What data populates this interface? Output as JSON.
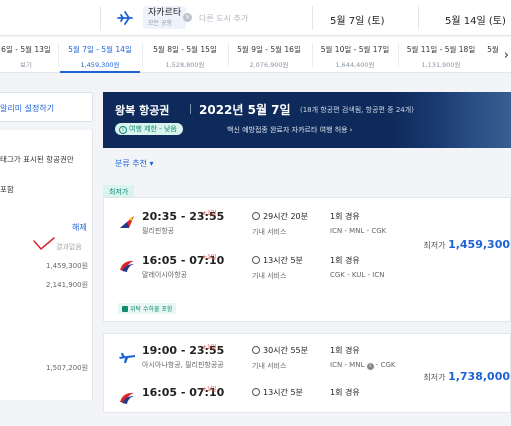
{
  "search": {
    "destination": {
      "city": "자카르타",
      "sub": "모든 공항"
    },
    "add_city_placeholder": "다른 도시 추가",
    "depart_date": "5월 7일 (토)",
    "return_date": "5월 14일 (토)"
  },
  "date_tabs": [
    {
      "range": "6일 - 5월 13일",
      "price": "보기",
      "active": false
    },
    {
      "range": "5월 7일 - 5월 14일",
      "price": "1,459,300원",
      "active": true
    },
    {
      "range": "5월 8일 - 5월 15일",
      "price": "1,528,800원",
      "active": false
    },
    {
      "range": "5월 9일 - 5월 16일",
      "price": "2,076,900원",
      "active": false
    },
    {
      "range": "5월 10일 - 5월 17일",
      "price": "1,644,400원",
      "active": false
    },
    {
      "range": "5월 11일 - 5월 18일",
      "price": "1,131,900원",
      "active": false
    },
    {
      "range": "5월",
      "price": "",
      "active": false
    }
  ],
  "left_panel": {
    "alarm_label": "알리미 설정하기",
    "tag_text": "태그가 표시된 항공권만",
    "include_text": "포함",
    "reset_label": "해제",
    "no_result": "결과없음",
    "prices": [
      "1,459,300원",
      "2,141,900원",
      "1,507,200원"
    ]
  },
  "header": {
    "trip_type": "왕복 항공권",
    "date": "2022년 5월 7일",
    "count_text": "(18개 항공편 검색됨, 항공편 중 24개)",
    "travel_badge": "여행 제한 - 낮음",
    "travel_note": "백신 예방접종 완료자 자카르타 여행 허용"
  },
  "sort_label": "분류 추천",
  "cheapest_tag": "최저가",
  "flights": [
    {
      "legs": [
        {
          "times": "20:35 - 23:55",
          "plus": "+1일",
          "airline": "필리핀항공",
          "logo": "philippine-airlines-logo",
          "duration": "29시간 20분",
          "service": "기내 서비스",
          "stops": "1회 경유",
          "route": "ICN - MNL - CGK"
        },
        {
          "times": "16:05 - 07:10",
          "plus": "+1일",
          "airline": "말레이시아항공",
          "logo": "malaysia-airlines-logo",
          "duration": "13시간 5분",
          "service": "기내 서비스",
          "stops": "1회 경유",
          "route": "CGK - KUL - ICN"
        }
      ],
      "price_prefix": "최저가",
      "price": "1,459,300",
      "refund": "위탁 수하물 포함"
    },
    {
      "legs": [
        {
          "times": "19:00 - 23:55",
          "plus": "+1일",
          "airline": "아시아나항공, 필리핀항공공",
          "logo": "plane-icon",
          "duration": "30시간 55분",
          "service": "기내 서비스",
          "stops": "1회 경유",
          "route": "ICN - MNL",
          "route_tail": "CGK"
        },
        {
          "times": "16:05 - 07:10",
          "plus": "+1일",
          "airline": "",
          "logo": "malaysia-airlines-logo",
          "duration": "13시간 5분",
          "service": "",
          "stops": "1회 경유",
          "route": ""
        }
      ],
      "price_prefix": "최저가",
      "price": "1,738,000",
      "refund": ""
    }
  ],
  "colors": {
    "accent": "#1e63d6",
    "header_bg": "#0e2a5a",
    "cheap_tag": "#0e8a70",
    "plus_day": "#e04a3a"
  }
}
